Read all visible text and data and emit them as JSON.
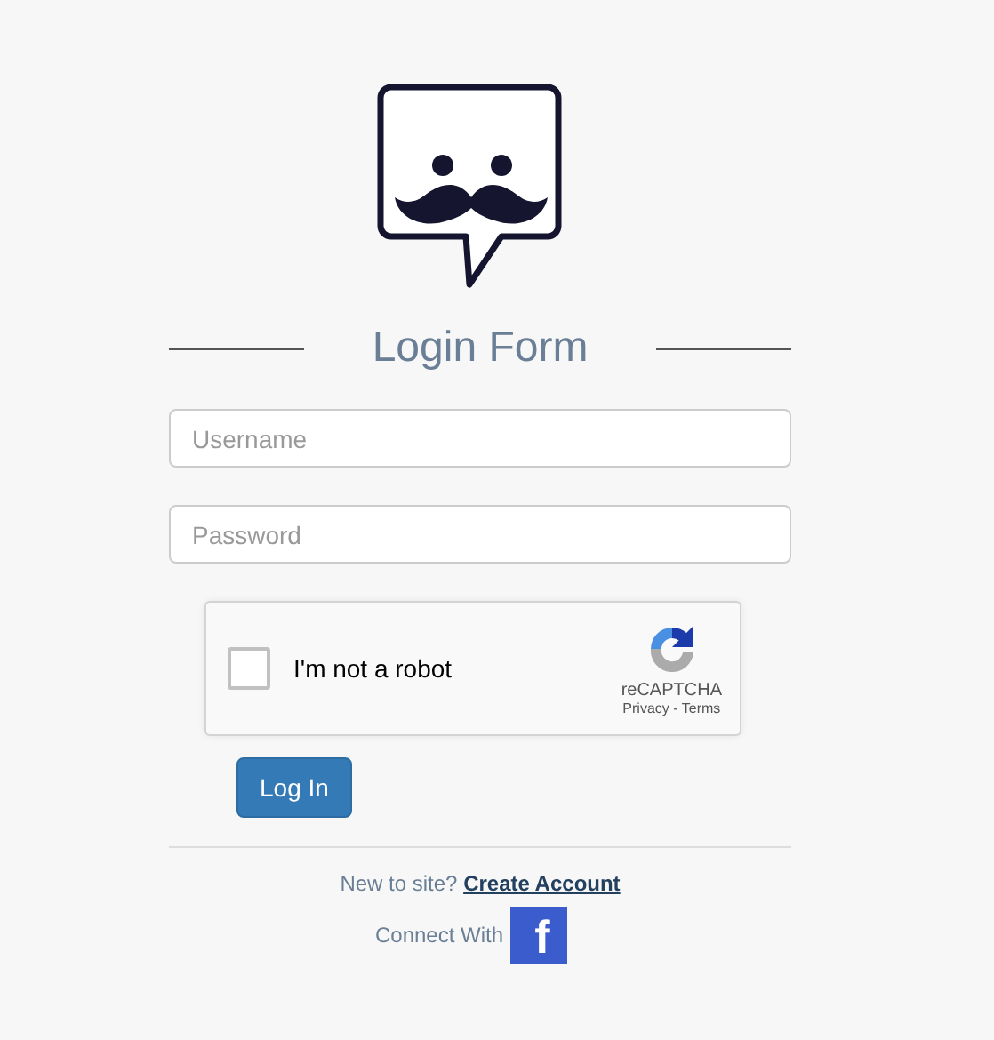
{
  "title": "Login Form",
  "fields": [
    {
      "placeholder": "Username"
    },
    {
      "placeholder": "Password"
    }
  ],
  "captcha": {
    "label": "I'm not a robot",
    "checked": false,
    "brand": "reCAPTCHA",
    "links": "Privacy - Terms"
  },
  "login_button": "Log In",
  "signup": {
    "prompt": "New to site?",
    "link": "Create Account"
  },
  "connect": {
    "label": "Connect With",
    "facebook": "f"
  }
}
